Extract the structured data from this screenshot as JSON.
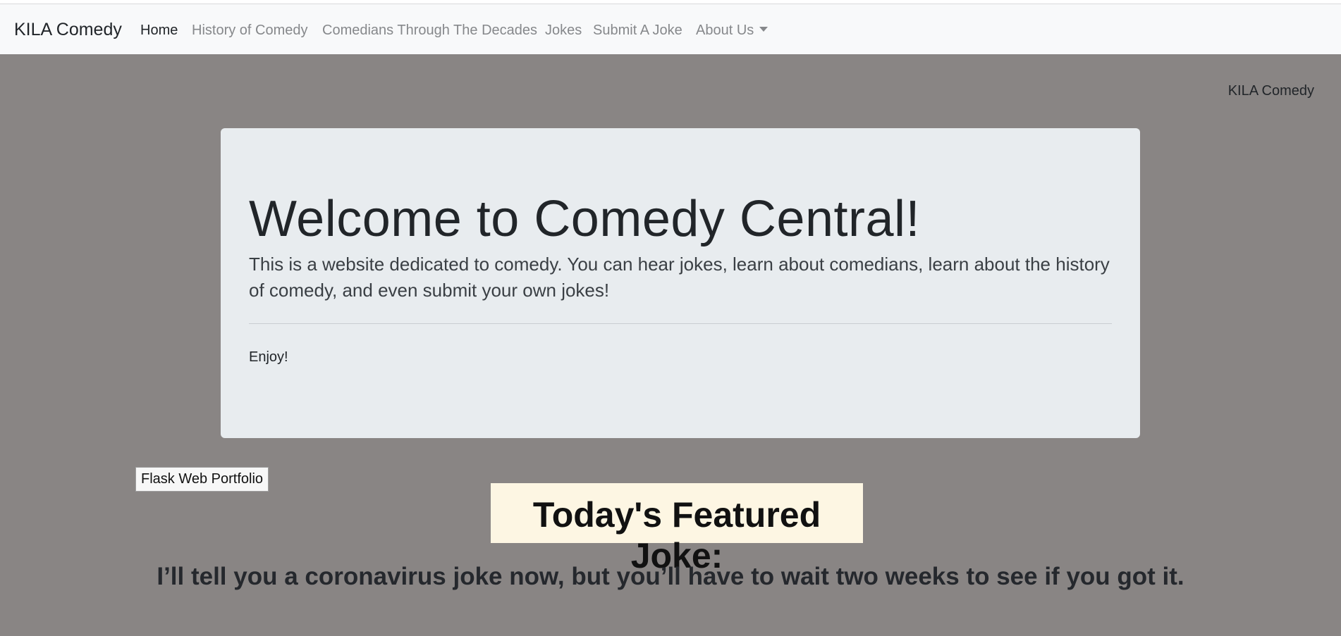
{
  "navbar": {
    "brand": "KILA Comedy",
    "links": [
      {
        "label": "Home",
        "active": true
      },
      {
        "label": "History of Comedy"
      },
      {
        "label": "Comedians Through The Decades"
      },
      {
        "label": "Jokes"
      },
      {
        "label": "Submit A Joke"
      },
      {
        "label": "About Us"
      }
    ]
  },
  "corner_label": "KILA Comedy",
  "jumbotron": {
    "title": "Welcome to Comedy Central!",
    "lead": "This is a website dedicated to comedy. You can hear jokes, learn about comedians, learn about the history of comedy, and even submit your own jokes!",
    "note": "Enjoy!"
  },
  "portfolio_button": "Flask Web Portfolio",
  "featured": {
    "title": "Today's Featured Joke:",
    "joke": "I’ll tell you a coronavirus joke now, but you’ll have to wait two weeks to see if you got it."
  },
  "colors": {
    "page_background": "#898584",
    "navbar_background": "#f8f9fa",
    "jumbotron_background": "#e8ecef",
    "featured_background": "#fdf6e3"
  }
}
